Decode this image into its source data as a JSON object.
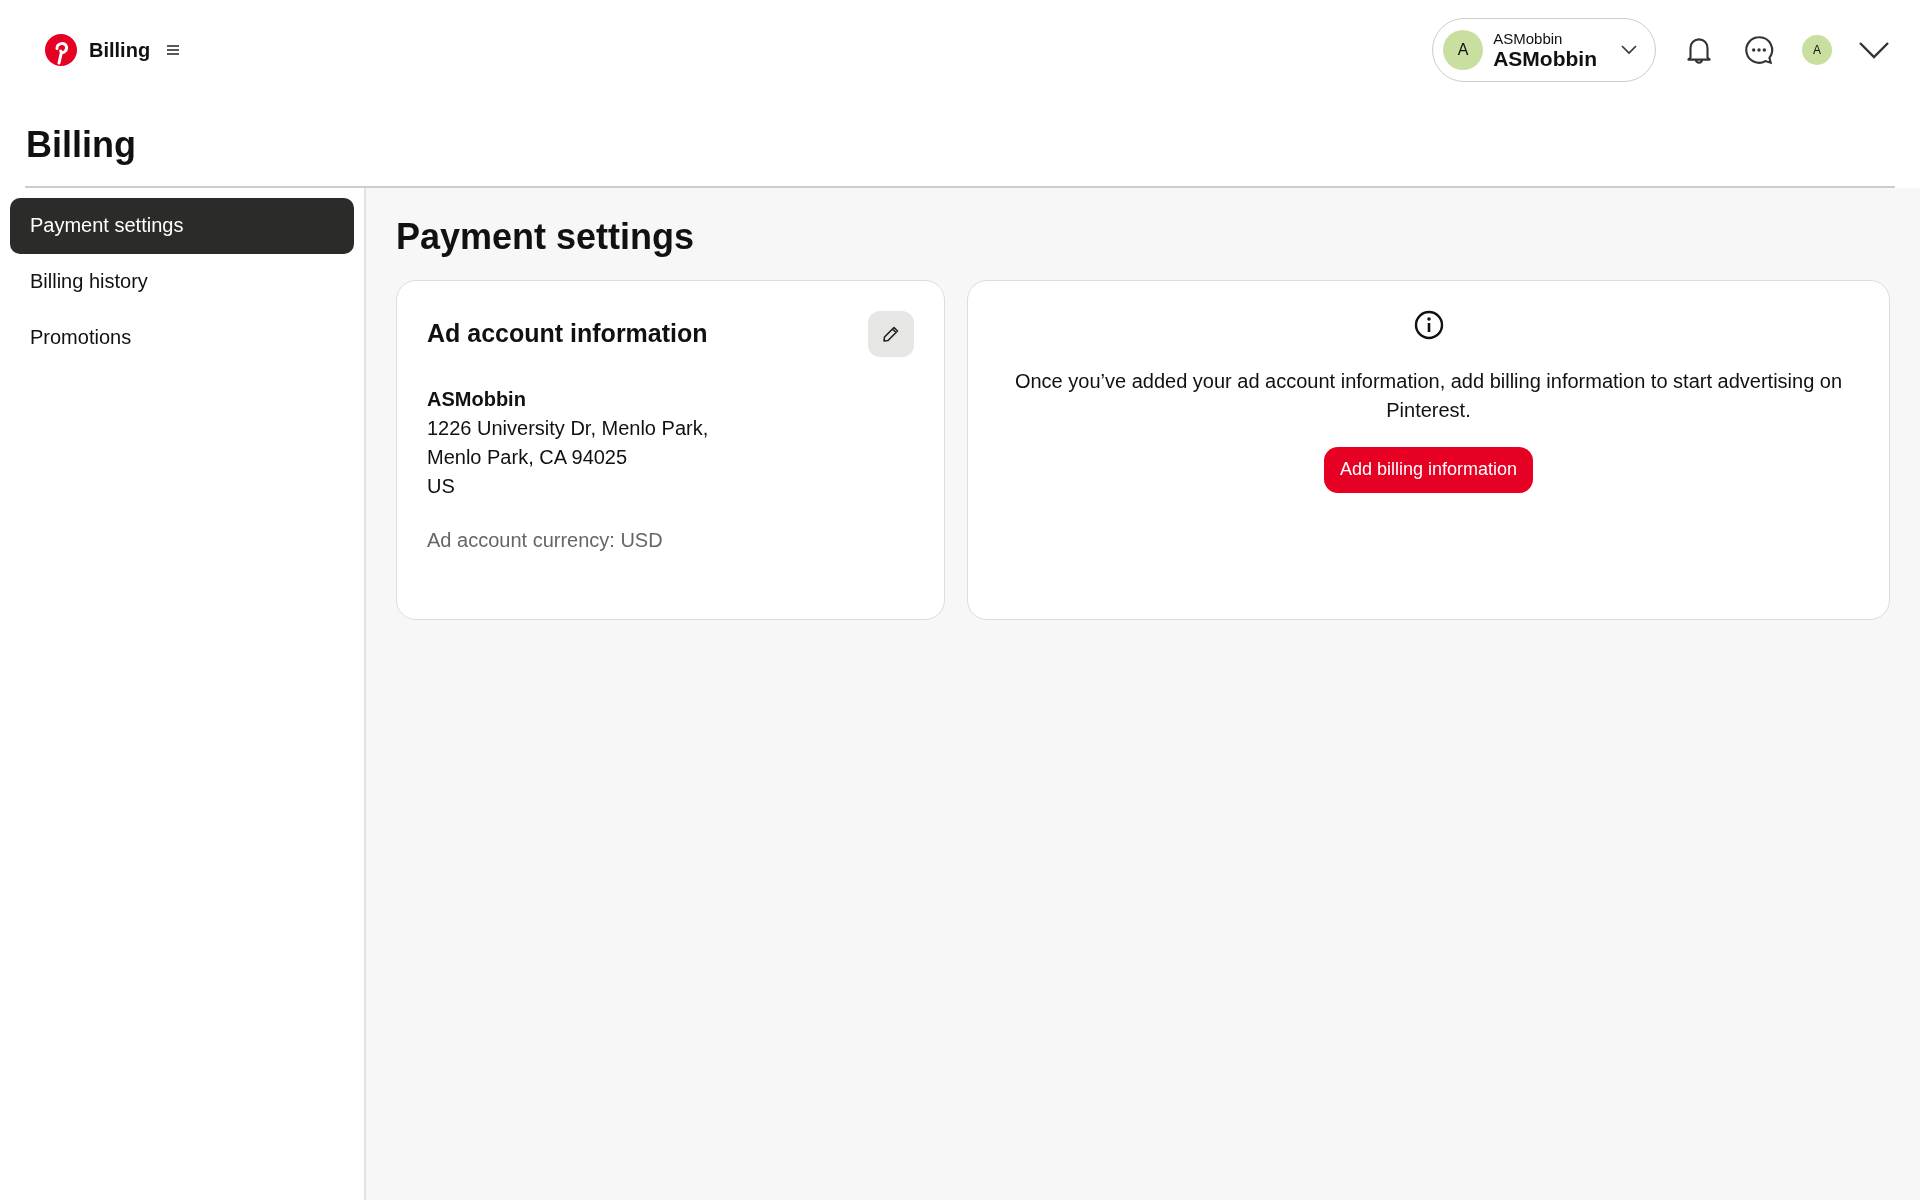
{
  "header": {
    "title": "Billing",
    "account": {
      "avatar": "A",
      "label": "ASMobbin",
      "name": "ASMobbin"
    },
    "user_avatar": "A"
  },
  "page_title": "Billing",
  "sidebar": {
    "items": [
      {
        "label": "Payment settings",
        "selected": true
      },
      {
        "label": "Billing history",
        "selected": false
      },
      {
        "label": "Promotions",
        "selected": false
      }
    ]
  },
  "main": {
    "title": "Payment settings",
    "ad_account_card": {
      "title": "Ad account information",
      "name": "ASMobbin",
      "address_lines": [
        "1226 University Dr, Menlo Park,",
        "Menlo Park, CA 94025",
        "US"
      ],
      "currency": "Ad account currency: USD"
    },
    "billing_card": {
      "message": "Once you’ve added your ad account information, add billing information to start advertising on Pinterest.",
      "button": "Add billing information"
    }
  }
}
